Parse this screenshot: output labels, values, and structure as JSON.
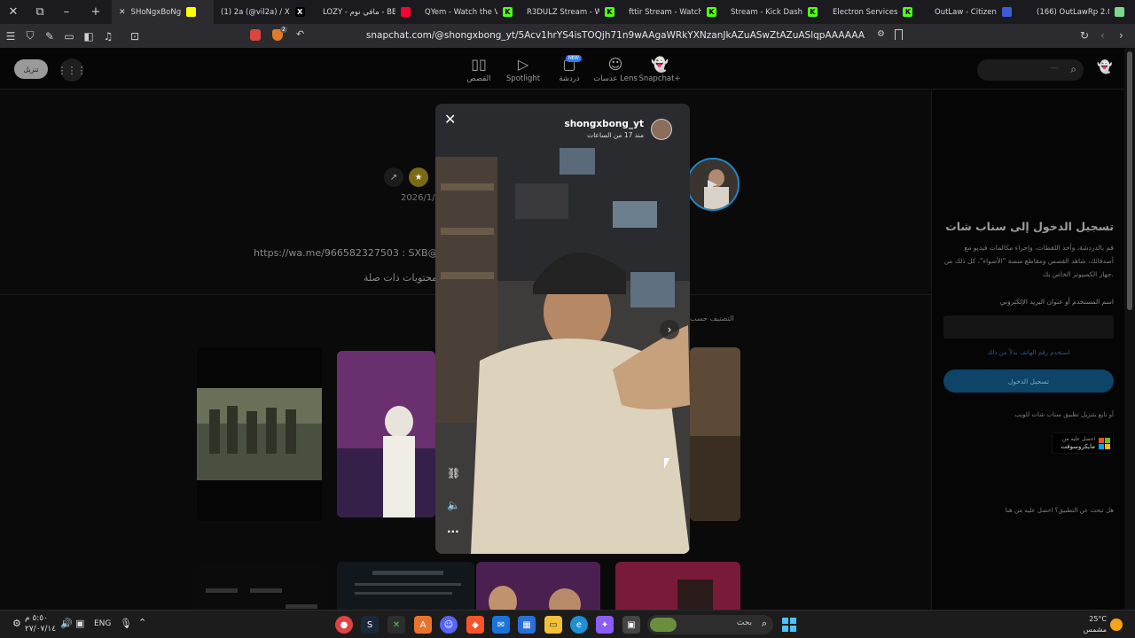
{
  "browser": {
    "tabs": [
      {
        "label": "SHoNgxBoNg",
        "active": true,
        "fav_color": "#fffc00",
        "fav_glyph": ""
      },
      {
        "label": "(1) 2a (@vil2a) / X",
        "active": false,
        "fav_color": "#000000",
        "fav_glyph": "X"
      },
      {
        "label": "LOZY - مافي نوم - BE",
        "active": false,
        "fav_color": "#ff0033",
        "fav_glyph": ""
      },
      {
        "label": "QYem - Watch the VO",
        "active": false,
        "fav_color": "#53fc18",
        "fav_glyph": "K"
      },
      {
        "label": "R3DULZ Stream - Watc",
        "active": false,
        "fav_color": "#53fc18",
        "fav_glyph": "K"
      },
      {
        "label": "fttir Stream - Watch Li",
        "active": false,
        "fav_color": "#53fc18",
        "fav_glyph": "K"
      },
      {
        "label": "Stream - Kick Dash",
        "active": false,
        "fav_color": "#53fc18",
        "fav_glyph": "K"
      },
      {
        "label": "Electron Services",
        "active": false,
        "fav_color": "#53fc18",
        "fav_glyph": "K"
      },
      {
        "label": "OutLaw - Citizen",
        "active": false,
        "fav_color": "#3a5cd9",
        "fav_glyph": ""
      },
      {
        "label": "(166) OutLawRp 2.0 - L",
        "active": false,
        "fav_color": "#7bd88f",
        "fav_glyph": ""
      }
    ],
    "shield_count": "2",
    "url": "snapchat.com/@shongxbong_yt/5Acv1hrYS4isTOQjh71n9wAAgaWRkYXNzanJkAZuASwZtAZuASlqpAAAAAA"
  },
  "header": {
    "download_label": "تنزيل",
    "nav": [
      {
        "label": "القصص",
        "icon": "stories-icon",
        "glyph": "▯▯"
      },
      {
        "label": "Spotlight",
        "icon": "play-icon",
        "glyph": "▷"
      },
      {
        "label": "دردشة",
        "icon": "chat-icon",
        "glyph": "▢",
        "badge": "NEW"
      },
      {
        "label": "عدسات Lens",
        "icon": "lens-icon",
        "glyph": "☺"
      },
      {
        "label": "Snapchat+",
        "icon": "ghost-icon",
        "glyph": "👻"
      }
    ],
    "search_placeholder": "—"
  },
  "profile": {
    "date": "2026/1/",
    "bio": "https://wa.me/966582327503 : SXB@pwr",
    "related": "محتويات ذات صلة",
    "sort": "التصنيف حسب"
  },
  "story": {
    "username": "shongxbong_yt",
    "time": "منذ 17 من الساعات"
  },
  "login": {
    "title": "تسجيل الدخول إلى سناب شات",
    "desc": "قم بالدردشة، وأخذ اللقطات، وإجراء مكالمات فيديو مع أصدقائك، شاهد القصص ومقاطع منصة \"الأضواء\"، كل ذلك من جهاز الكمبيوتر الخاص بك.",
    "field_label": "اسم المستخدم أو عنوان البريد الإلكتروني",
    "phone_link": "استخدم رقم الهاتف بدلاً من ذلك",
    "login_button": "تسجيل الدخول",
    "app_note": "أو تابع بتنزيل تطبيق سناب شات للويب",
    "ms_line1": "احصل عليه من",
    "ms_line2": "مايكروسوفت",
    "footer": "هل تبحث عن التطبيق؟ احصل عليه من هنا"
  },
  "taskbar": {
    "search_label": "بحث",
    "weather_temp": "25°C",
    "weather_cond": "مشمس",
    "lang": "ENG",
    "time": "٥:٥٠ م",
    "date": "٢٧/٠٧/١٤"
  }
}
